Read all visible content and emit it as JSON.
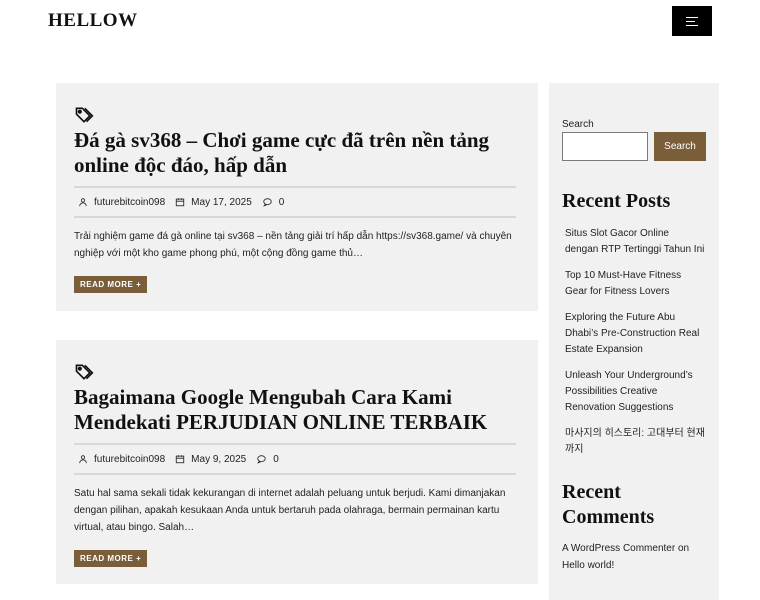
{
  "header": {
    "site_title": "HELLOW"
  },
  "posts": [
    {
      "title": "Đá gà sv368 – Chơi game cực đã trên nền tảng online độc đáo, hấp dẫn",
      "author": "futurebitcoin098",
      "date": "May 17, 2025",
      "comments": "0",
      "excerpt": "Trải nghiệm game đá gà online tại sv368 – nền tảng giải trí hấp dẫn https://sv368.game/ và chuyên nghiệp với một kho game phong phú, một cộng đồng game thủ…",
      "read_more": "READ MORE +"
    },
    {
      "title": "Bagaimana Google Mengubah Cara Kami Mendekati PERJUDIAN ONLINE TERBAIK",
      "author": "futurebitcoin098",
      "date": "May 9, 2025",
      "comments": "0",
      "excerpt": "Satu hal sama sekali tidak kekurangan di internet adalah peluang untuk berjudi. Kami dimanjakan dengan pilihan, apakah kesukaan Anda untuk bertaruh pada olahraga, bermain permainan kartu virtual, atau bingo. Salah…",
      "read_more": "READ MORE +"
    }
  ],
  "sidebar": {
    "search_label": "Search",
    "search_button": "Search",
    "recent_posts_title": "Recent Posts",
    "recent_posts": [
      "Situs Slot Gacor Online dengan RTP Tertinggi Tahun Ini",
      "Top 10 Must-Have Fitness Gear for Fitness Lovers",
      "Exploring the Future Abu Dhabi’s Pre-Construction Real Estate Expansion",
      "Unleash Your Underground’s Possibilities Creative Renovation Suggestions",
      "마사지의 히스토리: 고대부터 현재까지"
    ],
    "recent_comments_title": "Recent Comments",
    "recent_comment": "A WordPress Commenter on Hello world!"
  },
  "colors": {
    "accent": "#7a5e3a",
    "panel": "#f1f1f1",
    "menu_button": "#000000"
  }
}
